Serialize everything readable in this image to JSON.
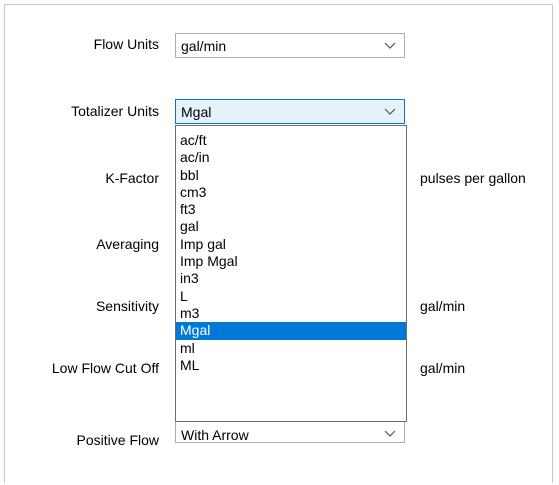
{
  "form": {
    "flow_units": {
      "label": "Flow Units",
      "value": "gal/min"
    },
    "totalizer_units": {
      "label": "Totalizer Units",
      "value": "Mgal",
      "options": [
        "ac/ft",
        "ac/in",
        "bbl",
        "cm3",
        "ft3",
        "gal",
        "Imp gal",
        "Imp Mgal",
        "in3",
        "L",
        "m3",
        "Mgal",
        "ml",
        "ML"
      ],
      "selected_index": 11
    },
    "k_factor": {
      "label": "K-Factor",
      "unit": "pulses per gallon"
    },
    "averaging": {
      "label": "Averaging"
    },
    "sensitivity": {
      "label": "Sensitivity",
      "unit": "gal/min"
    },
    "low_flow_cut_off": {
      "label": "Low Flow Cut Off",
      "unit": "gal/min"
    },
    "positive_flow": {
      "label": "Positive Flow",
      "value": "With Arrow"
    }
  },
  "colors": {
    "selection": "#0078d7",
    "focus_border": "#0078d7",
    "focus_fill": "#e5f1fb",
    "panel_border": "#c9c9c9"
  },
  "icons": {
    "dropdown_arrow": "chevron-down-icon"
  }
}
